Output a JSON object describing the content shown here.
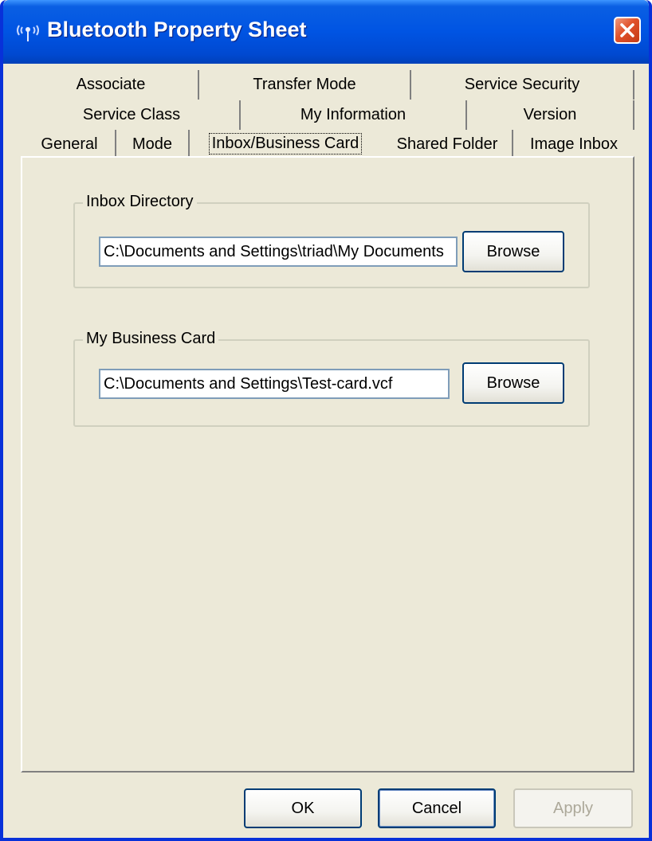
{
  "window": {
    "title": "Bluetooth Property Sheet"
  },
  "tabs": {
    "row1": [
      "Associate",
      "Transfer Mode",
      "Service Security"
    ],
    "row2": [
      "Service Class",
      "My Information",
      "Version"
    ],
    "row3": [
      "General",
      "Mode",
      "Inbox/Business Card",
      "Shared Folder",
      "Image Inbox"
    ],
    "active": "Inbox/Business Card"
  },
  "inbox_directory": {
    "label": "Inbox Directory",
    "path": "C:\\Documents and Settings\\triad\\My Documents",
    "browse_label": "Browse"
  },
  "business_card": {
    "label": "My Business Card",
    "path": "C:\\Documents and Settings\\Test-card.vcf",
    "browse_label": "Browse"
  },
  "footer": {
    "ok_label": "OK",
    "cancel_label": "Cancel",
    "apply_label": "Apply"
  },
  "colors": {
    "titlebar": "#0054E3",
    "dialog_bg": "#ECE9D8",
    "close_button": "#E0512A",
    "disabled_text": "#ACA899"
  },
  "icons": {
    "title_icon": "bluetooth-antenna-icon",
    "close_icon": "close-x-icon"
  }
}
